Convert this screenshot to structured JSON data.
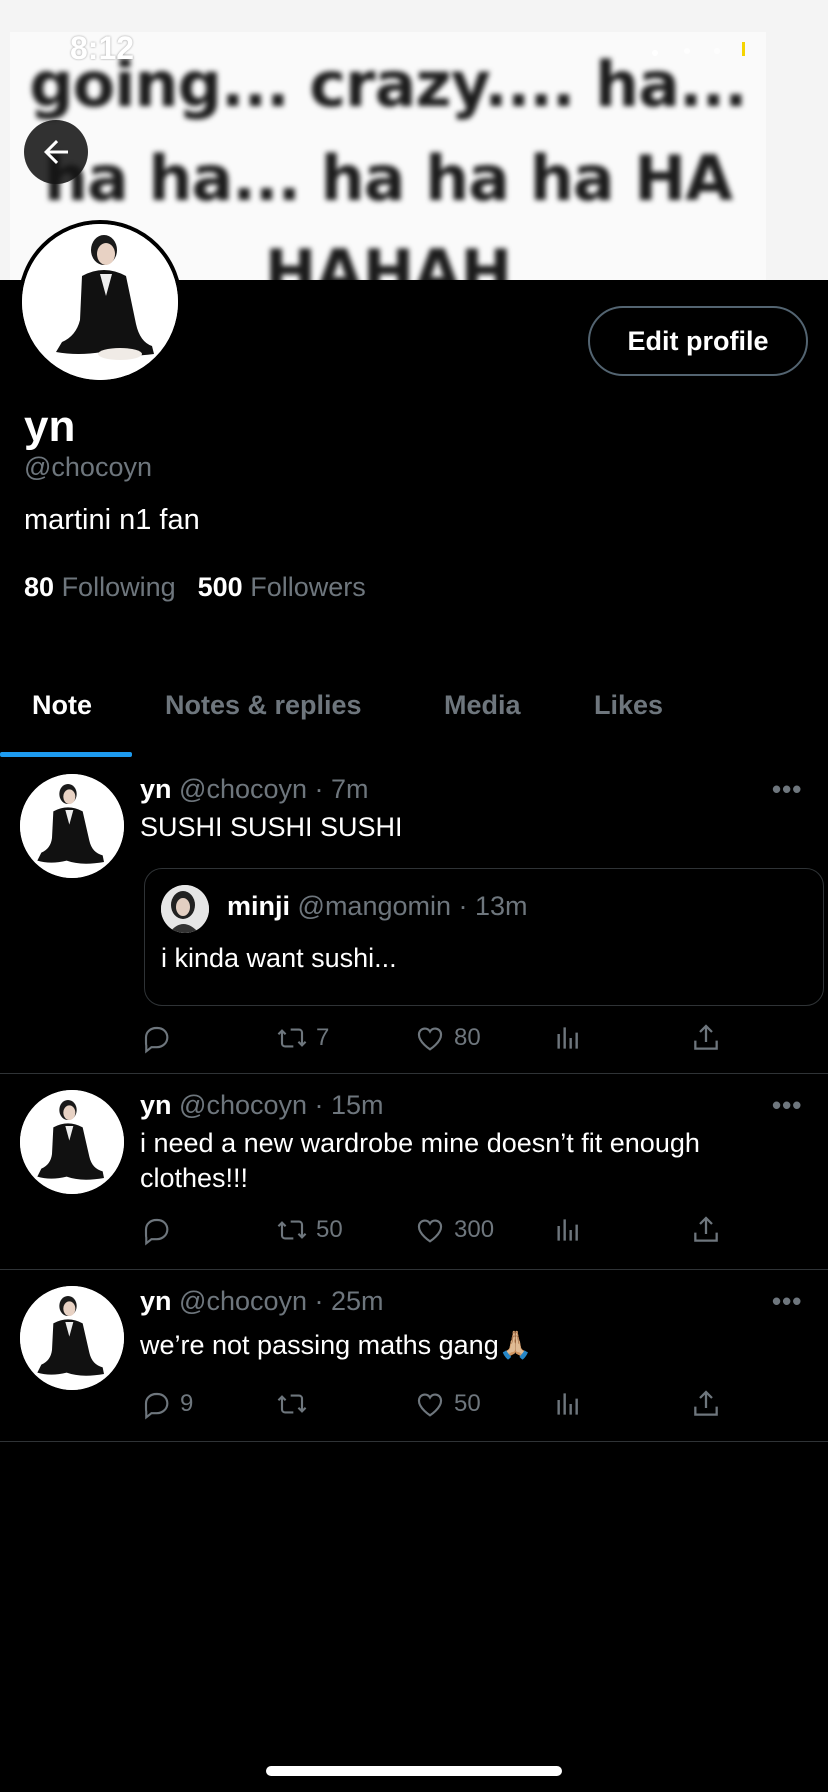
{
  "status_bar": {
    "time": "8:12"
  },
  "banner": {
    "lines": [
      "going... crazy.... ha...",
      "ha ha... ha ha ha HA",
      "HAHAH"
    ]
  },
  "profile": {
    "name": "yn",
    "handle": "@chocoyn",
    "bio": "martini n1 fan",
    "following_count": "80",
    "following_label": "Following",
    "followers_count": "500",
    "followers_label": "Followers",
    "edit_button": "Edit profile"
  },
  "tabs": [
    {
      "label": "Note",
      "active": true
    },
    {
      "label": "Notes & replies",
      "active": false
    },
    {
      "label": "Media",
      "active": false
    },
    {
      "label": "Likes",
      "active": false
    }
  ],
  "tweets": [
    {
      "name": "yn",
      "handle": "@chocoyn",
      "time": "7m",
      "text": "SUSHI SUSHI SUSHI",
      "quote": {
        "name": "minji",
        "handle": "@mangomin",
        "time": "13m",
        "text": "i kinda want sushi..."
      },
      "replies": "",
      "retweets": "7",
      "likes": "80"
    },
    {
      "name": "yn",
      "handle": "@chocoyn",
      "time": "15m",
      "text": "i need a new wardrobe mine doesn’t fit enough clothes!!!",
      "replies": "",
      "retweets": "50",
      "likes": "300"
    },
    {
      "name": "yn",
      "handle": "@chocoyn",
      "time": "25m",
      "text": "we’re not passing maths gang🙏🏼",
      "replies": "9",
      "retweets": "",
      "likes": "50"
    }
  ],
  "icons": {
    "back": "arrow-left-icon",
    "more": "more-icon",
    "reply": "reply-icon",
    "retweet": "retweet-icon",
    "like": "heart-icon",
    "views": "views-icon",
    "share": "share-icon"
  },
  "colors": {
    "accent": "#1d9bf0",
    "muted": "#6e767d",
    "border": "#2f3336"
  }
}
